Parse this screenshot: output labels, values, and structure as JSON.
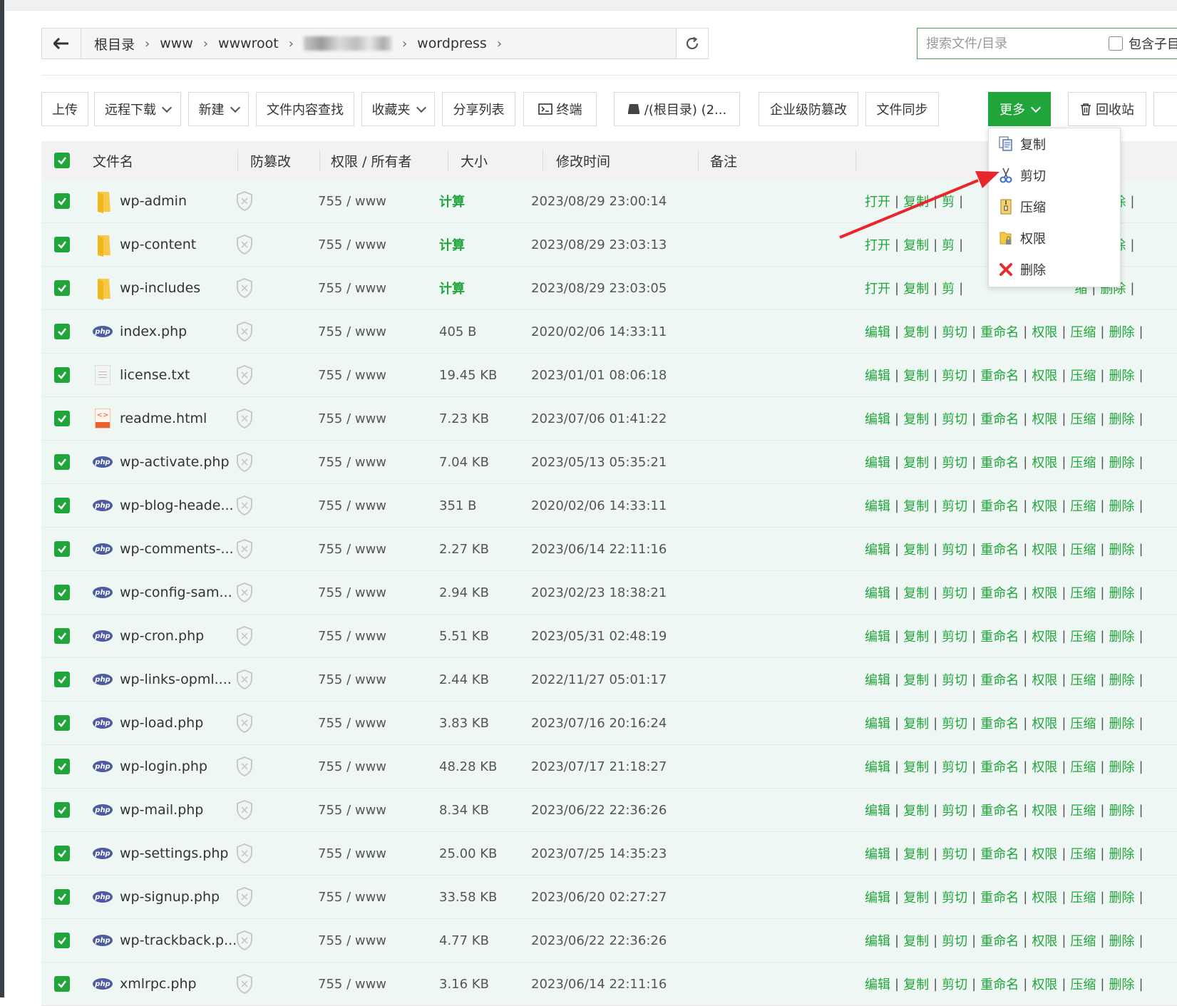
{
  "breadcrumb": {
    "items": [
      "根目录",
      "www",
      "wwwroot",
      "wordpress"
    ]
  },
  "search": {
    "placeholder": "搜索文件/目录",
    "include_sub_label": "包含子目录"
  },
  "toolbar": {
    "upload": "上传",
    "remote_download": "远程下载",
    "new": "新建",
    "content_search": "文件内容查找",
    "favorites": "收藏夹",
    "share_list": "分享列表",
    "terminal": "终端",
    "disk": "/(根目录) (2...",
    "enterprise_protect": "企业级防篡改",
    "file_sync": "文件同步",
    "more": "更多",
    "recycle": "回收站"
  },
  "columns": {
    "filename": "文件名",
    "protect": "防篡改",
    "perm_owner": "权限 / 所有者",
    "size": "大小",
    "mtime": "修改时间",
    "note": "备注"
  },
  "dropdown": {
    "items": [
      {
        "label": "复制",
        "icon": "copy-icon"
      },
      {
        "label": "剪切",
        "icon": "scissors-icon"
      },
      {
        "label": "压缩",
        "icon": "zip-icon"
      },
      {
        "label": "权限",
        "icon": "lock-folder-icon"
      },
      {
        "label": "删除",
        "icon": "delete-x-icon"
      }
    ]
  },
  "folder_ops": [
    "打开",
    "复制",
    "剪",
    "缩",
    "删除"
  ],
  "file_ops": [
    "编辑",
    "复制",
    "剪切",
    "重命名",
    "权限",
    "压缩",
    "删除"
  ],
  "files": [
    {
      "name": "wp-admin",
      "type": "folder",
      "perm": "755 / www",
      "size": "计算",
      "mtime": "2023/08/29 23:00:14"
    },
    {
      "name": "wp-content",
      "type": "folder",
      "perm": "755 / www",
      "size": "计算",
      "mtime": "2023/08/29 23:03:13"
    },
    {
      "name": "wp-includes",
      "type": "folder",
      "perm": "755 / www",
      "size": "计算",
      "mtime": "2023/08/29 23:03:05"
    },
    {
      "name": "index.php",
      "type": "php",
      "perm": "755 / www",
      "size": "405 B",
      "mtime": "2020/02/06 14:33:11"
    },
    {
      "name": "license.txt",
      "type": "txt",
      "perm": "755 / www",
      "size": "19.45 KB",
      "mtime": "2023/01/01 08:06:18"
    },
    {
      "name": "readme.html",
      "type": "html",
      "perm": "755 / www",
      "size": "7.23 KB",
      "mtime": "2023/07/06 01:41:22"
    },
    {
      "name": "wp-activate.php",
      "type": "php",
      "perm": "755 / www",
      "size": "7.04 KB",
      "mtime": "2023/05/13 05:35:21"
    },
    {
      "name": "wp-blog-heade...",
      "type": "php",
      "perm": "755 / www",
      "size": "351 B",
      "mtime": "2020/02/06 14:33:11"
    },
    {
      "name": "wp-comments-...",
      "type": "php",
      "perm": "755 / www",
      "size": "2.27 KB",
      "mtime": "2023/06/14 22:11:16"
    },
    {
      "name": "wp-config-sam...",
      "type": "php",
      "perm": "755 / www",
      "size": "2.94 KB",
      "mtime": "2023/02/23 18:38:21"
    },
    {
      "name": "wp-cron.php",
      "type": "php",
      "perm": "755 / www",
      "size": "5.51 KB",
      "mtime": "2023/05/31 02:48:19"
    },
    {
      "name": "wp-links-opml....",
      "type": "php",
      "perm": "755 / www",
      "size": "2.44 KB",
      "mtime": "2022/11/27 05:01:17"
    },
    {
      "name": "wp-load.php",
      "type": "php",
      "perm": "755 / www",
      "size": "3.83 KB",
      "mtime": "2023/07/16 20:16:24"
    },
    {
      "name": "wp-login.php",
      "type": "php",
      "perm": "755 / www",
      "size": "48.28 KB",
      "mtime": "2023/07/17 21:18:27"
    },
    {
      "name": "wp-mail.php",
      "type": "php",
      "perm": "755 / www",
      "size": "8.34 KB",
      "mtime": "2023/06/22 22:36:26"
    },
    {
      "name": "wp-settings.php",
      "type": "php",
      "perm": "755 / www",
      "size": "25.00 KB",
      "mtime": "2023/07/25 14:35:23"
    },
    {
      "name": "wp-signup.php",
      "type": "php",
      "perm": "755 / www",
      "size": "33.58 KB",
      "mtime": "2023/06/20 02:27:27"
    },
    {
      "name": "wp-trackback.p...",
      "type": "php",
      "perm": "755 / www",
      "size": "4.77 KB",
      "mtime": "2023/06/22 22:36:26"
    },
    {
      "name": "xmlrpc.php",
      "type": "php",
      "perm": "755 / www",
      "size": "3.16 KB",
      "mtime": "2023/06/14 22:11:16"
    }
  ],
  "colors": {
    "accent": "#20a53a",
    "row_bg": "#eef7f3",
    "arrow": "#e8262b"
  }
}
